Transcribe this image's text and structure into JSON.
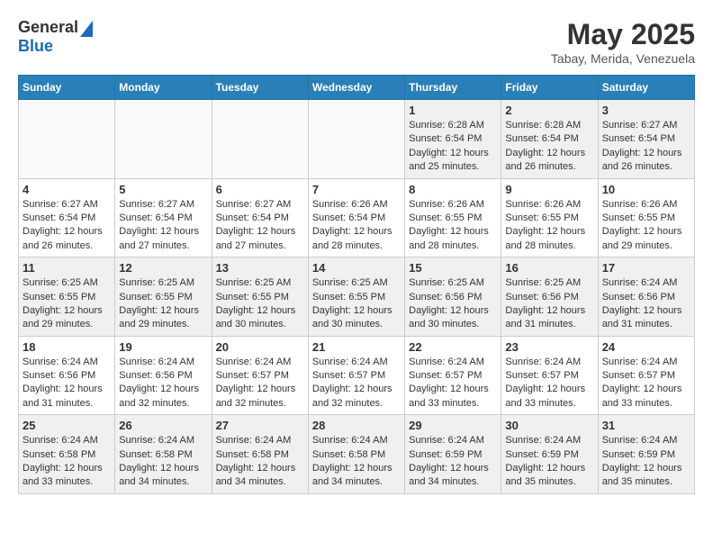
{
  "header": {
    "logo_general": "General",
    "logo_blue": "Blue",
    "month_title": "May 2025",
    "location": "Tabay, Merida, Venezuela"
  },
  "weekdays": [
    "Sunday",
    "Monday",
    "Tuesday",
    "Wednesday",
    "Thursday",
    "Friday",
    "Saturday"
  ],
  "weeks": [
    [
      {
        "day": "",
        "info": ""
      },
      {
        "day": "",
        "info": ""
      },
      {
        "day": "",
        "info": ""
      },
      {
        "day": "",
        "info": ""
      },
      {
        "day": "1",
        "info": "Sunrise: 6:28 AM\nSunset: 6:54 PM\nDaylight: 12 hours and 25 minutes."
      },
      {
        "day": "2",
        "info": "Sunrise: 6:28 AM\nSunset: 6:54 PM\nDaylight: 12 hours and 26 minutes."
      },
      {
        "day": "3",
        "info": "Sunrise: 6:27 AM\nSunset: 6:54 PM\nDaylight: 12 hours and 26 minutes."
      }
    ],
    [
      {
        "day": "4",
        "info": "Sunrise: 6:27 AM\nSunset: 6:54 PM\nDaylight: 12 hours and 26 minutes."
      },
      {
        "day": "5",
        "info": "Sunrise: 6:27 AM\nSunset: 6:54 PM\nDaylight: 12 hours and 27 minutes."
      },
      {
        "day": "6",
        "info": "Sunrise: 6:27 AM\nSunset: 6:54 PM\nDaylight: 12 hours and 27 minutes."
      },
      {
        "day": "7",
        "info": "Sunrise: 6:26 AM\nSunset: 6:54 PM\nDaylight: 12 hours and 28 minutes."
      },
      {
        "day": "8",
        "info": "Sunrise: 6:26 AM\nSunset: 6:55 PM\nDaylight: 12 hours and 28 minutes."
      },
      {
        "day": "9",
        "info": "Sunrise: 6:26 AM\nSunset: 6:55 PM\nDaylight: 12 hours and 28 minutes."
      },
      {
        "day": "10",
        "info": "Sunrise: 6:26 AM\nSunset: 6:55 PM\nDaylight: 12 hours and 29 minutes."
      }
    ],
    [
      {
        "day": "11",
        "info": "Sunrise: 6:25 AM\nSunset: 6:55 PM\nDaylight: 12 hours and 29 minutes."
      },
      {
        "day": "12",
        "info": "Sunrise: 6:25 AM\nSunset: 6:55 PM\nDaylight: 12 hours and 29 minutes."
      },
      {
        "day": "13",
        "info": "Sunrise: 6:25 AM\nSunset: 6:55 PM\nDaylight: 12 hours and 30 minutes."
      },
      {
        "day": "14",
        "info": "Sunrise: 6:25 AM\nSunset: 6:55 PM\nDaylight: 12 hours and 30 minutes."
      },
      {
        "day": "15",
        "info": "Sunrise: 6:25 AM\nSunset: 6:56 PM\nDaylight: 12 hours and 30 minutes."
      },
      {
        "day": "16",
        "info": "Sunrise: 6:25 AM\nSunset: 6:56 PM\nDaylight: 12 hours and 31 minutes."
      },
      {
        "day": "17",
        "info": "Sunrise: 6:24 AM\nSunset: 6:56 PM\nDaylight: 12 hours and 31 minutes."
      }
    ],
    [
      {
        "day": "18",
        "info": "Sunrise: 6:24 AM\nSunset: 6:56 PM\nDaylight: 12 hours and 31 minutes."
      },
      {
        "day": "19",
        "info": "Sunrise: 6:24 AM\nSunset: 6:56 PM\nDaylight: 12 hours and 32 minutes."
      },
      {
        "day": "20",
        "info": "Sunrise: 6:24 AM\nSunset: 6:57 PM\nDaylight: 12 hours and 32 minutes."
      },
      {
        "day": "21",
        "info": "Sunrise: 6:24 AM\nSunset: 6:57 PM\nDaylight: 12 hours and 32 minutes."
      },
      {
        "day": "22",
        "info": "Sunrise: 6:24 AM\nSunset: 6:57 PM\nDaylight: 12 hours and 33 minutes."
      },
      {
        "day": "23",
        "info": "Sunrise: 6:24 AM\nSunset: 6:57 PM\nDaylight: 12 hours and 33 minutes."
      },
      {
        "day": "24",
        "info": "Sunrise: 6:24 AM\nSunset: 6:57 PM\nDaylight: 12 hours and 33 minutes."
      }
    ],
    [
      {
        "day": "25",
        "info": "Sunrise: 6:24 AM\nSunset: 6:58 PM\nDaylight: 12 hours and 33 minutes."
      },
      {
        "day": "26",
        "info": "Sunrise: 6:24 AM\nSunset: 6:58 PM\nDaylight: 12 hours and 34 minutes."
      },
      {
        "day": "27",
        "info": "Sunrise: 6:24 AM\nSunset: 6:58 PM\nDaylight: 12 hours and 34 minutes."
      },
      {
        "day": "28",
        "info": "Sunrise: 6:24 AM\nSunset: 6:58 PM\nDaylight: 12 hours and 34 minutes."
      },
      {
        "day": "29",
        "info": "Sunrise: 6:24 AM\nSunset: 6:59 PM\nDaylight: 12 hours and 34 minutes."
      },
      {
        "day": "30",
        "info": "Sunrise: 6:24 AM\nSunset: 6:59 PM\nDaylight: 12 hours and 35 minutes."
      },
      {
        "day": "31",
        "info": "Sunrise: 6:24 AM\nSunset: 6:59 PM\nDaylight: 12 hours and 35 minutes."
      }
    ]
  ]
}
